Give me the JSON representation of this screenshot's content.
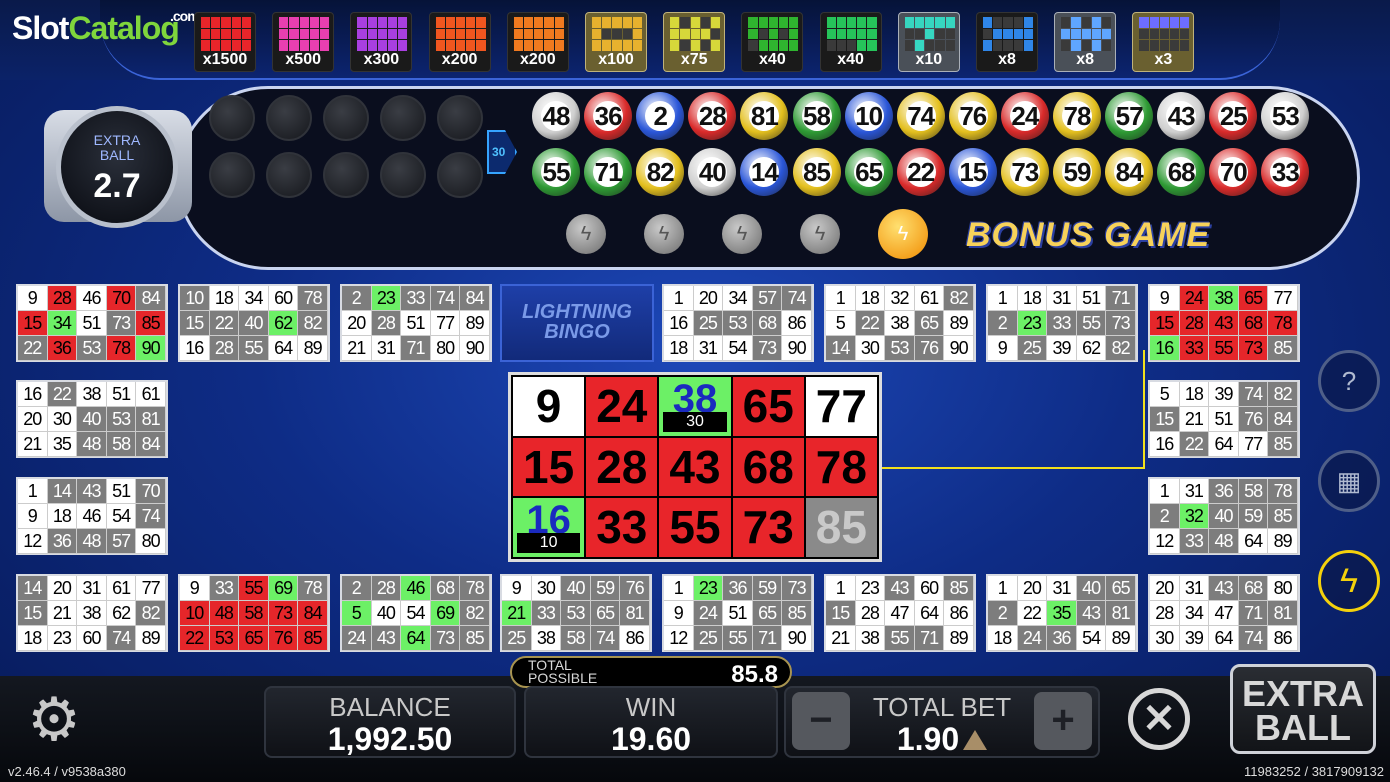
{
  "brand": {
    "slot": "Slot",
    "catalog": "Catalog",
    "com": ".com"
  },
  "paytable": [
    {
      "mult": "x1500",
      "color": "#e8252a",
      "hi": ""
    },
    {
      "mult": "x500",
      "color": "#e83fb0",
      "hi": ""
    },
    {
      "mult": "x300",
      "color": "#a93fe0",
      "hi": ""
    },
    {
      "mult": "x200",
      "color": "#f0561f",
      "hi": ""
    },
    {
      "mult": "x200",
      "color": "#f07a1f",
      "hi": ""
    },
    {
      "mult": "x100",
      "color": "#e7b12e",
      "hi": "hi"
    },
    {
      "mult": "x75",
      "color": "#d7d83a",
      "hi": "hi"
    },
    {
      "mult": "x40",
      "color": "#2fb42f",
      "hi": ""
    },
    {
      "mult": "x40",
      "color": "#26c45a",
      "hi": ""
    },
    {
      "mult": "x10",
      "color": "#36d6c0",
      "hi": "hi2"
    },
    {
      "mult": "x8",
      "color": "#2f86e8",
      "hi": ""
    },
    {
      "mult": "x8",
      "color": "#5fa6ff",
      "hi": "hi2"
    },
    {
      "mult": "x3",
      "color": "#6d6dff",
      "hi": "hi"
    }
  ],
  "extra_ball": {
    "label_line1": "EXTRA",
    "label_line2": "BALL",
    "value": "2.7"
  },
  "ball_count_marker": "30",
  "drawn_balls": [
    [
      48,
      36,
      2,
      28,
      81,
      58,
      10,
      74,
      76,
      24,
      78,
      57,
      43,
      25,
      53
    ],
    [
      55,
      71,
      82,
      40,
      14,
      85,
      65,
      22,
      15,
      73,
      59,
      84,
      68,
      70,
      33
    ]
  ],
  "bonus_game_title": "BONUS GAME",
  "bonus_bolts": [
    false,
    false,
    false,
    false,
    true
  ],
  "logo_card_text": "LIGHTNING BINGO",
  "cards": [
    {
      "rows": [
        [
          "9",
          "28",
          "46",
          "70",
          "84"
        ],
        [
          "15",
          "34",
          "51",
          "73",
          "85"
        ],
        [
          "22",
          "36",
          "53",
          "78",
          "90"
        ]
      ],
      "marks": [
        [
          "",
          "r",
          "",
          "r",
          "g"
        ],
        [
          "r",
          "m",
          "",
          "g",
          "r"
        ],
        [
          "g",
          "r",
          "g",
          "r",
          "m"
        ]
      ]
    },
    {
      "rows": [
        [
          "10",
          "18",
          "34",
          "60",
          "78"
        ],
        [
          "15",
          "22",
          "40",
          "62",
          "82"
        ],
        [
          "16",
          "28",
          "55",
          "64",
          "89"
        ]
      ],
      "marks": [
        [
          "g",
          "",
          "",
          "",
          "g"
        ],
        [
          "g",
          "g",
          "g",
          "m",
          "g"
        ],
        [
          "",
          "g",
          "g",
          "",
          ""
        ]
      ]
    },
    {
      "rows": [
        [
          "2",
          "23",
          "33",
          "74",
          "84"
        ],
        [
          "20",
          "28",
          "51",
          "77",
          "89"
        ],
        [
          "21",
          "31",
          "71",
          "80",
          "90"
        ]
      ],
      "marks": [
        [
          "g",
          "m",
          "g",
          "g",
          "g"
        ],
        [
          "",
          "g",
          "",
          "",
          ""
        ],
        [
          "",
          "",
          "g",
          "",
          ""
        ]
      ]
    },
    {
      "rows": [
        [
          "1",
          "20",
          "34",
          "57",
          "74"
        ],
        [
          "16",
          "25",
          "53",
          "68",
          "86"
        ],
        [
          "18",
          "31",
          "54",
          "73",
          "90"
        ]
      ],
      "marks": [
        [
          "",
          "",
          "",
          "g",
          "g"
        ],
        [
          "",
          "g",
          "g",
          "g",
          ""
        ],
        [
          "",
          "",
          "",
          "g",
          ""
        ]
      ]
    },
    {
      "rows": [
        [
          "1",
          "18",
          "32",
          "61",
          "82"
        ],
        [
          "5",
          "22",
          "38",
          "65",
          "89"
        ],
        [
          "14",
          "30",
          "53",
          "76",
          "90"
        ]
      ],
      "marks": [
        [
          "",
          "",
          "",
          "",
          "g"
        ],
        [
          "",
          "g",
          "",
          "g",
          ""
        ],
        [
          "g",
          "",
          "g",
          "g",
          ""
        ]
      ]
    },
    {
      "rows": [
        [
          "1",
          "18",
          "31",
          "51",
          "71"
        ],
        [
          "2",
          "23",
          "33",
          "55",
          "73"
        ],
        [
          "9",
          "25",
          "39",
          "62",
          "82"
        ]
      ],
      "marks": [
        [
          "",
          "",
          "",
          "",
          "g"
        ],
        [
          "g",
          "m",
          "g",
          "g",
          "g"
        ],
        [
          "",
          "g",
          "",
          "",
          "g"
        ]
      ]
    },
    {
      "rows": [
        [
          "9",
          "24",
          "38",
          "65",
          "77"
        ],
        [
          "15",
          "28",
          "43",
          "68",
          "78"
        ],
        [
          "16",
          "33",
          "55",
          "73",
          "85"
        ]
      ],
      "marks": [
        [
          "",
          "r",
          "m",
          "r",
          ""
        ],
        [
          "r",
          "r",
          "r",
          "r",
          "r"
        ],
        [
          "m",
          "r",
          "r",
          "r",
          "g"
        ]
      ]
    },
    {
      "rows": [
        [
          "16",
          "22",
          "38",
          "51",
          "61"
        ],
        [
          "20",
          "30",
          "40",
          "53",
          "81"
        ],
        [
          "21",
          "35",
          "48",
          "58",
          "84"
        ]
      ],
      "marks": [
        [
          "",
          "g",
          "",
          "",
          ""
        ],
        [
          "",
          "",
          "g",
          "g",
          "g"
        ],
        [
          "",
          "",
          "g",
          "g",
          "g"
        ]
      ]
    },
    {
      "rows": [
        [
          "5",
          "18",
          "39",
          "74",
          "82"
        ],
        [
          "15",
          "21",
          "51",
          "76",
          "84"
        ],
        [
          "16",
          "22",
          "64",
          "77",
          "85"
        ]
      ],
      "marks": [
        [
          "",
          "",
          "",
          "g",
          "g"
        ],
        [
          "g",
          "",
          "",
          "g",
          "g"
        ],
        [
          "",
          "g",
          "",
          "",
          "g"
        ]
      ]
    },
    {
      "rows": [
        [
          "1",
          "14",
          "43",
          "51",
          "70"
        ],
        [
          "9",
          "18",
          "46",
          "54",
          "74"
        ],
        [
          "12",
          "36",
          "48",
          "57",
          "80"
        ]
      ],
      "marks": [
        [
          "",
          "g",
          "g",
          "",
          "g"
        ],
        [
          "",
          "",
          "",
          "",
          "g"
        ],
        [
          "",
          "g",
          "g",
          "g",
          ""
        ]
      ]
    },
    {
      "rows": [
        [
          "1",
          "31",
          "36",
          "58",
          "78"
        ],
        [
          "2",
          "32",
          "40",
          "59",
          "85"
        ],
        [
          "12",
          "33",
          "48",
          "64",
          "89"
        ]
      ],
      "marks": [
        [
          "",
          "",
          "g",
          "g",
          "g"
        ],
        [
          "g",
          "m",
          "g",
          "g",
          "g"
        ],
        [
          "",
          "g",
          "g",
          "",
          ""
        ]
      ]
    },
    {
      "rows": [
        [
          "14",
          "20",
          "31",
          "61",
          "77"
        ],
        [
          "15",
          "21",
          "38",
          "62",
          "82"
        ],
        [
          "18",
          "23",
          "60",
          "74",
          "89"
        ]
      ],
      "marks": [
        [
          "g",
          "",
          "",
          "",
          ""
        ],
        [
          "g",
          "",
          "",
          "",
          "g"
        ],
        [
          "",
          "",
          "",
          "g",
          ""
        ]
      ]
    },
    {
      "rows": [
        [
          "9",
          "33",
          "55",
          "69",
          "78"
        ],
        [
          "10",
          "48",
          "58",
          "73",
          "84"
        ],
        [
          "22",
          "53",
          "65",
          "76",
          "85"
        ]
      ],
      "marks": [
        [
          "",
          "g",
          "r",
          "m",
          "g"
        ],
        [
          "r",
          "r",
          "r",
          "r",
          "r"
        ],
        [
          "r",
          "r",
          "r",
          "r",
          "r"
        ]
      ]
    },
    {
      "rows": [
        [
          "2",
          "28",
          "46",
          "68",
          "78"
        ],
        [
          "5",
          "40",
          "54",
          "69",
          "82"
        ],
        [
          "24",
          "43",
          "64",
          "73",
          "85"
        ]
      ],
      "marks": [
        [
          "g",
          "g",
          "m",
          "g",
          "g"
        ],
        [
          "m",
          "",
          "",
          "m",
          "g"
        ],
        [
          "g",
          "g",
          "m",
          "g",
          "g"
        ]
      ]
    },
    {
      "rows": [
        [
          "9",
          "30",
          "40",
          "59",
          "76"
        ],
        [
          "21",
          "33",
          "53",
          "65",
          "81"
        ],
        [
          "25",
          "38",
          "58",
          "74",
          "86"
        ]
      ],
      "marks": [
        [
          "",
          "",
          "g",
          "g",
          "g"
        ],
        [
          "m",
          "g",
          "g",
          "g",
          "g"
        ],
        [
          "g",
          "",
          "g",
          "g",
          ""
        ]
      ]
    },
    {
      "rows": [
        [
          "1",
          "23",
          "36",
          "59",
          "73"
        ],
        [
          "9",
          "24",
          "51",
          "65",
          "85"
        ],
        [
          "12",
          "25",
          "55",
          "71",
          "90"
        ]
      ],
      "marks": [
        [
          "",
          "m",
          "g",
          "g",
          "g"
        ],
        [
          "",
          "g",
          "",
          "g",
          "g"
        ],
        [
          "",
          "g",
          "g",
          "g",
          ""
        ]
      ]
    },
    {
      "rows": [
        [
          "1",
          "23",
          "43",
          "60",
          "85"
        ],
        [
          "15",
          "28",
          "47",
          "64",
          "86"
        ],
        [
          "21",
          "38",
          "55",
          "71",
          "89"
        ]
      ],
      "marks": [
        [
          "",
          "",
          "g",
          "",
          "g"
        ],
        [
          "g",
          "",
          "",
          "",
          ""
        ],
        [
          "",
          "",
          "g",
          "g",
          ""
        ]
      ]
    },
    {
      "rows": [
        [
          "1",
          "20",
          "31",
          "40",
          "65"
        ],
        [
          "2",
          "22",
          "35",
          "43",
          "81"
        ],
        [
          "18",
          "24",
          "36",
          "54",
          "89"
        ]
      ],
      "marks": [
        [
          "",
          "",
          "",
          "g",
          "g"
        ],
        [
          "g",
          "",
          "m",
          "g",
          "g"
        ],
        [
          "",
          "g",
          "g",
          "",
          ""
        ]
      ]
    },
    {
      "rows": [
        [
          "20",
          "31",
          "43",
          "68",
          "80"
        ],
        [
          "28",
          "34",
          "47",
          "71",
          "81"
        ],
        [
          "30",
          "39",
          "64",
          "74",
          "86"
        ]
      ],
      "marks": [
        [
          "",
          "",
          "g",
          "g",
          ""
        ],
        [
          "",
          "",
          "",
          "g",
          "g"
        ],
        [
          "",
          "",
          "",
          "g",
          ""
        ]
      ]
    }
  ],
  "zoom_card": {
    "rows": [
      [
        "9",
        "24",
        "38",
        "65",
        "77"
      ],
      [
        "15",
        "28",
        "43",
        "68",
        "78"
      ],
      [
        "16",
        "33",
        "55",
        "73",
        "85"
      ]
    ],
    "marks": [
      [
        "",
        "r",
        "m",
        "r",
        ""
      ],
      [
        "r",
        "r",
        "r",
        "r",
        "r"
      ],
      [
        "m",
        "r",
        "r",
        "r",
        "g"
      ]
    ],
    "subs": [
      [
        "",
        "",
        "30",
        "",
        ""
      ],
      [
        "",
        "",
        "",
        "",
        ""
      ],
      [
        "10",
        "",
        "",
        "",
        ""
      ]
    ]
  },
  "total_possible": {
    "label_line1": "TOTAL",
    "label_line2": "POSSIBLE",
    "value": "85.8"
  },
  "balance": {
    "label": "BALANCE",
    "value": "1,992.50"
  },
  "win": {
    "label": "WIN",
    "value": "19.60"
  },
  "total_bet": {
    "label": "TOTAL BET",
    "value": "1.90",
    "minus": "−",
    "plus": "+"
  },
  "extra_ball_button": {
    "line1": "EXTRA",
    "line2": "BALL"
  },
  "version": "v2.46.4 / v9538a380",
  "ids": "11983252 / 3817909132"
}
